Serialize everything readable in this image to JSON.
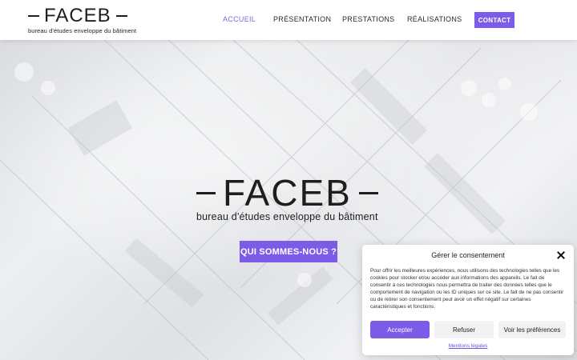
{
  "header": {
    "logo_name": "FACEB",
    "logo_tagline": "bureau d'études enveloppe du bâtiment",
    "nav": [
      {
        "label": "ACCUEIL",
        "active": true
      },
      {
        "label": "PRÉSENTATION",
        "active": false
      },
      {
        "label": "PRESTATIONS",
        "active": false
      },
      {
        "label": "RÉALISATIONS",
        "active": false
      }
    ],
    "contact_label": "CONTACT"
  },
  "hero": {
    "title": "FACEB",
    "subtitle": "bureau d'études enveloppe du bâtiment",
    "cta_label": "QUI SOMMES-NOUS ?"
  },
  "consent": {
    "title": "Gérer le consentement",
    "text": "Pour offrir les meilleures expériences, nous utilisons des technologies telles que les cookies pour stocker et/ou accéder aux informations des appareils. Le fait de consentir à ces technologies nous permettra de traiter des données telles que le comportement de navigation ou les ID uniques sur ce site. Le fait de ne pas consentir ou de retirer son consentement peut avoir un effet négatif sur certaines caractéristiques et fonctions.",
    "accept_label": "Accepter",
    "refuse_label": "Refuser",
    "prefs_label": "Voir les préférences",
    "legal_label": "Mentions légales"
  },
  "colors": {
    "accent": "#7b5be8",
    "active_nav": "#7b68d9",
    "text": "#1e1e1e"
  }
}
